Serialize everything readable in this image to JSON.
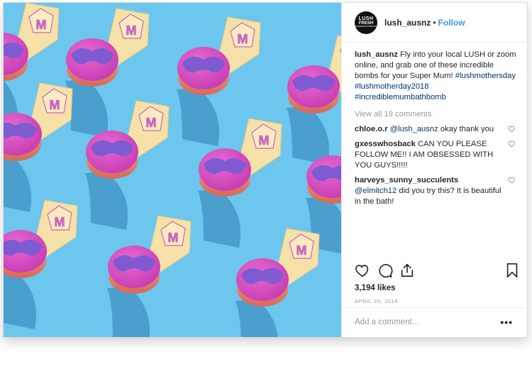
{
  "post": {
    "username": "lush_ausnz",
    "separator": "•",
    "follow_label": "Follow",
    "logo_text": [
      "LUSH",
      "FRESH",
      "HANDMADE COSMETICS"
    ],
    "caption_user": "lush_ausnz",
    "caption_text": "Fly into your local LUSH or zoom online, and grab one of these incredible bombs for your Super Mum!",
    "caption_tags": [
      "#lushmothersday",
      "#lushmotherday2018",
      "#incrediblemumbathbomb"
    ],
    "view_all": "View all 19 comments",
    "comments": [
      {
        "user": "chloe.o.r",
        "mention": "@lush_ausnz",
        "text": "okay thank you"
      },
      {
        "user": "gxesswhosback",
        "mention": "",
        "text": "CAN YOU PLEASE FOLLOW ME!! I AM OBSESSED WITH YOU GUYS!!!!!"
      },
      {
        "user": "harveys_sunny_succulents",
        "mention": "@elmitch12",
        "text": "did you try this? It is beautiful in the bath!"
      }
    ],
    "likes": "3,194 likes",
    "date": "APRIL 29, 2018",
    "add_comment_placeholder": "Add a comment...",
    "more_label": "•••"
  },
  "icons": {
    "like": "heart-icon",
    "comment": "comment-bubble-icon",
    "share": "share-icon",
    "save": "bookmark-icon"
  },
  "colors": {
    "photo_bg": "#6cc6ee",
    "link": "#3897f0",
    "hashtag": "#003569",
    "bomb_top": "#c93fb4",
    "mask": "#7f5bd1",
    "bomb_bottom": "#e8866f",
    "cape": "#f6e1a8"
  }
}
